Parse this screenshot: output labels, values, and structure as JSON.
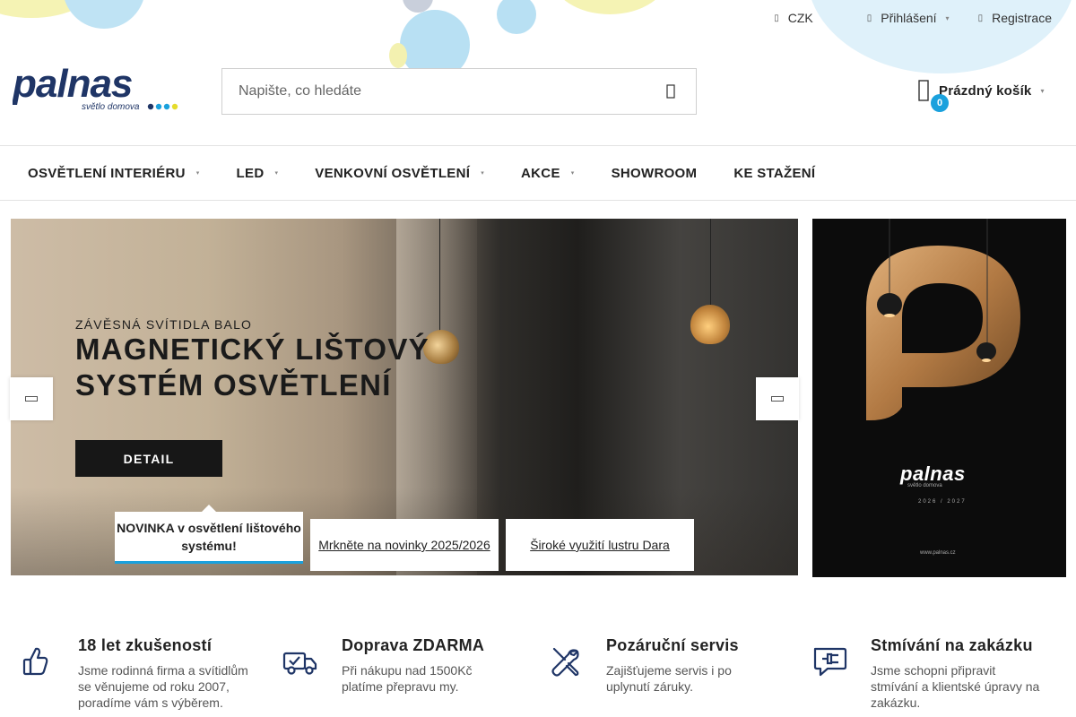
{
  "topbar": {
    "currency": "CZK",
    "login": "Přihlášení",
    "register": "Registrace"
  },
  "header": {
    "logo_text": "palnas",
    "logo_tagline": "světlo domova",
    "search_placeholder": "Napište, co hledáte",
    "cart_count": "0",
    "cart_label": "Prázdný košík"
  },
  "nav": {
    "items": [
      {
        "label": "OSVĚTLENÍ INTERIÉRU",
        "has_dropdown": true
      },
      {
        "label": "LED",
        "has_dropdown": true
      },
      {
        "label": "VENKOVNÍ OSVĚTLENÍ",
        "has_dropdown": true
      },
      {
        "label": "AKCE",
        "has_dropdown": true
      },
      {
        "label": "SHOWROOM",
        "has_dropdown": false
      },
      {
        "label": "KE STAŽENÍ",
        "has_dropdown": false
      }
    ]
  },
  "hero": {
    "subtitle": "ZÁVĚSNÁ SVÍTIDLA BALO",
    "title": "MAGNETICKÝ LIŠTOVÝ SYSTÉM OSVĚTLENÍ",
    "button": "DETAIL",
    "tabs": [
      {
        "label": "NOVINKA v osvětlení lištového systému!",
        "active": true
      },
      {
        "label": "Mrkněte na novinky 2025/2026",
        "active": false
      },
      {
        "label": "Široké využití lustru Dara",
        "active": false
      }
    ]
  },
  "side_banner": {
    "logo_text": "palnas",
    "tagline": "světlo domova",
    "years": "2026 / 2027",
    "url": "www.palnas.cz"
  },
  "benefits": [
    {
      "icon": "thumbs-up-icon",
      "title": "18 let zkušeností",
      "text": "Jsme rodinná firma a svítidlům se věnujeme od roku 2007, poradíme vám s výběrem."
    },
    {
      "icon": "delivery-truck-icon",
      "title": "Doprava ZDARMA",
      "text": "Při nákupu nad 1500Kč platíme přepravu my."
    },
    {
      "icon": "tools-icon",
      "title": "Pozáruční servis",
      "text": "Zajišťujeme servis i po uplynutí záruky."
    },
    {
      "icon": "chat-plug-icon",
      "title": "Stmívání na zakázku",
      "text": "Jsme schopni připravit stmívání a klientské úpravy na zakázku."
    }
  ],
  "colors": {
    "accent": "#1aa1dd",
    "brand_navy": "#1f3566",
    "bubble_blue": "#a9dbf1",
    "bubble_yellow": "#f5f3b4"
  }
}
